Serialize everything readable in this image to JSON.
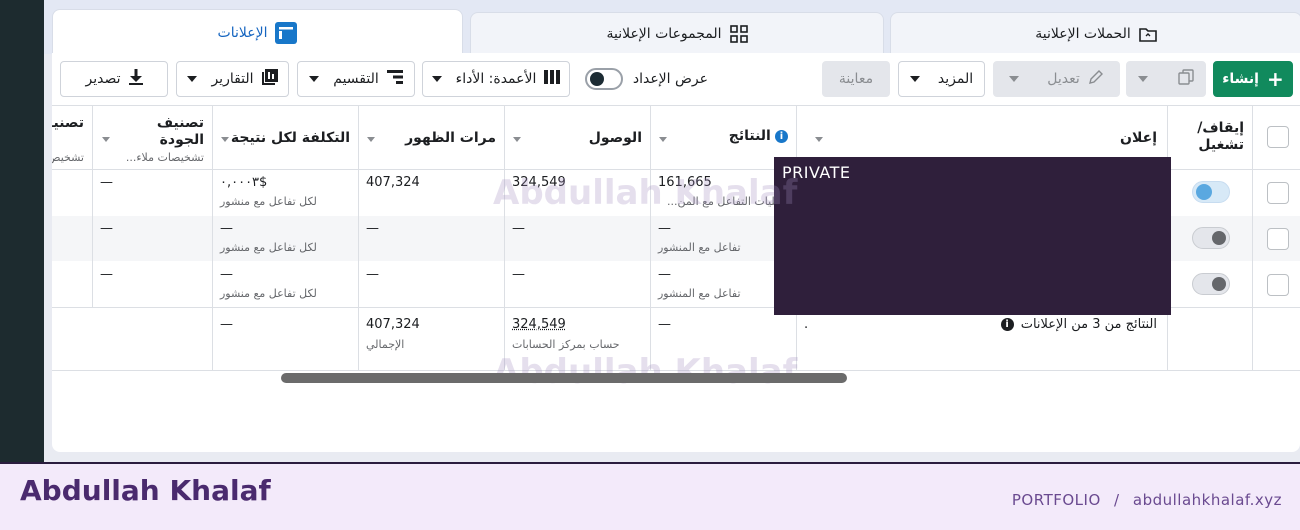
{
  "tabs": [
    {
      "label": "الحملات الإعلانية",
      "icon": "folder-icon"
    },
    {
      "label": "المجموعات الإعلانية",
      "icon": "grid-icon"
    },
    {
      "label": "الإعلانات",
      "icon": "ad-icon",
      "active": true
    }
  ],
  "toolbar": {
    "create": "إنشاء",
    "edit": "تعديل",
    "more": "المزيد",
    "preview": "معاينة",
    "setup_view": "عرض الإعداد",
    "columns": "الأعمدة: الأداء",
    "breakdown": "التقسيم",
    "reports": "التقارير",
    "export": "تصدير"
  },
  "columns": {
    "toggle": "إيقاف/ تشغيل",
    "ad": "إعلان",
    "results": "النتائج",
    "reach": "الوصول",
    "impressions": "مرات الظهور",
    "cost": "التكلفة لكل نتيجة",
    "quality": "تصنيف الجودة",
    "quality_sub": "تشخيصات ملاء...",
    "engagement": "تصنيف التفاعل",
    "engagement_sub": "تشخيص"
  },
  "rows": [
    {
      "active": true,
      "results": "161,665",
      "results_sub": "عمليات التفاعل مع المن...",
      "reach": "324,549",
      "impressions": "407,324",
      "cost": "٠,٠٠٠٣$",
      "cost_sub": "لكل تفاعل مع منشور",
      "quality": "—"
    },
    {
      "active": false,
      "results": "—",
      "results_sub": "تفاعل مع المنشور",
      "reach": "—",
      "impressions": "—",
      "cost": "—",
      "cost_sub": "لكل تفاعل مع منشور",
      "quality": "—"
    },
    {
      "active": false,
      "results": "—",
      "results_sub": "تفاعل مع المنشور",
      "reach": "—",
      "impressions": "—",
      "cost": "—",
      "cost_sub": "لكل تفاعل مع منشور",
      "quality": "—"
    }
  ],
  "summary": {
    "label": "النتائج من 3 من الإعلانات",
    "dot": ".",
    "results": "—",
    "reach": "324,549",
    "reach_sub": "حساب بمركز الحسابات",
    "impressions": "407,324",
    "impressions_sub": "الإجمالي",
    "cost": "—"
  },
  "private_label": "PRIVATE",
  "watermark": "Abdullah Khalaf",
  "footer": {
    "brand": "Abdullah Khalaf",
    "link1": "PORTFOLIO",
    "sep": "/",
    "link2": "abdullahkhalaf.xyz"
  }
}
